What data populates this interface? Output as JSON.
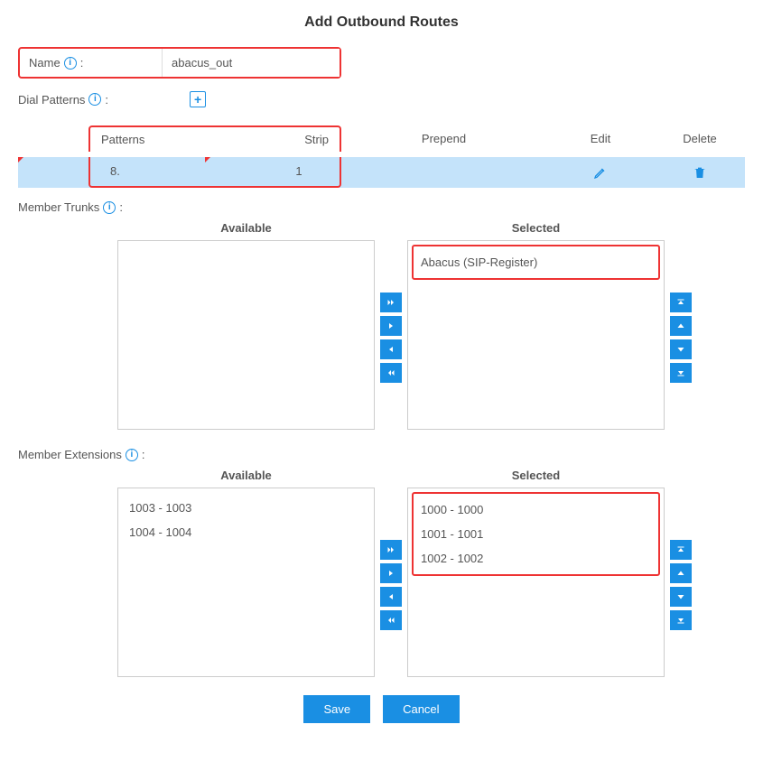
{
  "title": "Add Outbound Routes",
  "name_field": {
    "label": "Name",
    "value": "abacus_out"
  },
  "dial_patterns": {
    "label": "Dial Patterns",
    "columns": {
      "patterns": "Patterns",
      "strip": "Strip",
      "prepend": "Prepend",
      "edit": "Edit",
      "delete": "Delete"
    },
    "rows": [
      {
        "pattern": "8.",
        "strip": "1",
        "prepend": ""
      }
    ]
  },
  "member_trunks": {
    "label": "Member Trunks",
    "available_title": "Available",
    "selected_title": "Selected",
    "available": [],
    "selected": [
      "Abacus (SIP-Register)"
    ]
  },
  "member_extensions": {
    "label": "Member Extensions",
    "available_title": "Available",
    "selected_title": "Selected",
    "available": [
      "1003 - 1003",
      "1004 - 1004"
    ],
    "selected": [
      "1000 - 1000",
      "1001 - 1001",
      "1002 - 1002"
    ]
  },
  "buttons": {
    "save": "Save",
    "cancel": "Cancel"
  },
  "colon": ":"
}
